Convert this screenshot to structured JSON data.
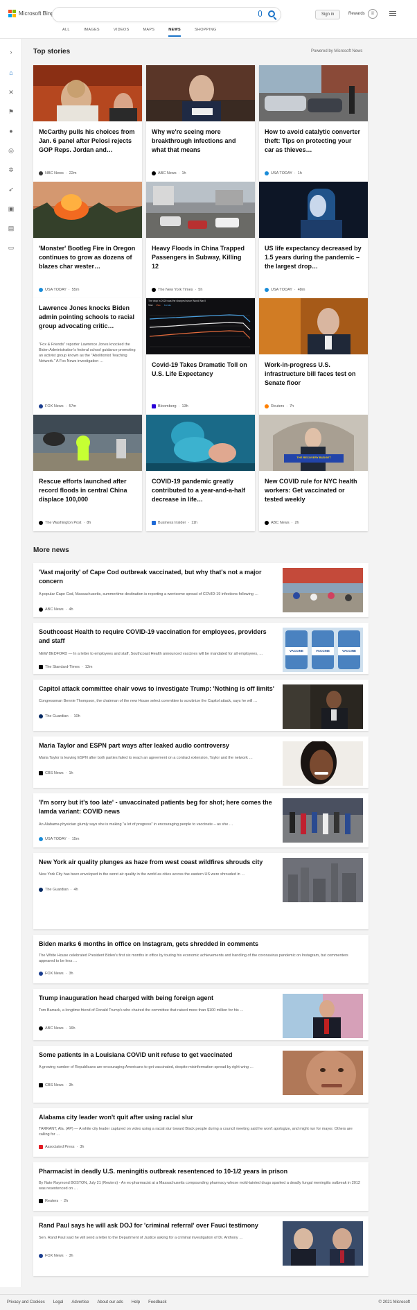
{
  "header": {
    "logo_text": "Microsoft Bing",
    "signin_label": "Sign in",
    "rewards_label": "Rewards",
    "tabs": [
      {
        "label": "ALL"
      },
      {
        "label": "IMAGES"
      },
      {
        "label": "VIDEOS"
      },
      {
        "label": "MAPS"
      },
      {
        "label": "NEWS",
        "active": true
      },
      {
        "label": "SHOPPING"
      }
    ]
  },
  "top_stories": {
    "title": "Top stories",
    "powered_by": "Powered by Microsoft News",
    "cards": [
      {
        "title": "McCarthy pulls his choices from Jan. 6 panel after Pelosi rejects GOP Reps. Jordan and…",
        "source": "NBC News",
        "age": "22m",
        "logo_color": "#333"
      },
      {
        "title": "Why we're seeing more breakthrough infections and what that means",
        "source": "ABC News",
        "age": "1h",
        "logo_color": "#000"
      },
      {
        "title": "How to avoid catalytic converter theft: Tips on protecting your car as thieves…",
        "source": "USA TODAY",
        "age": "1h",
        "logo_color": "#1a8cd8"
      },
      {
        "title": "'Monster' Bootleg Fire in Oregon continues to grow as dozens of blazes char wester…",
        "source": "USA TODAY",
        "age": "55m",
        "logo_color": "#1a8cd8"
      },
      {
        "title": "Heavy Floods in China Trapped Passengers in Subway, Killing 12",
        "source": "The New York Times",
        "age": "5h",
        "logo_color": "#000"
      },
      {
        "title": "US life expectancy decreased by 1.5 years during the pandemic – the largest drop…",
        "source": "USA TODAY",
        "age": "48m",
        "logo_color": "#1a8cd8"
      },
      {
        "title": "Lawrence Jones knocks Biden admin pointing schools to racial group advocating critic…",
        "snippet": "\"Fox & Friends\" reporter Lawrence Jones knocked the Biden Administration's federal school guidance promoting an activist group known as the \"Abolitionist Teaching Network.\" A Fox News investigation …",
        "source": "FOX News",
        "age": "57m",
        "logo_color": "#1a3d8f"
      },
      {
        "title": "Covid-19 Takes Dramatic Toll on U.S. Life Expectancy",
        "source": "Bloomberg",
        "age": "13h",
        "logo_color": "#2800d7"
      },
      {
        "title": "Work-in-progress U.S. infrastructure bill faces test on Senate floor",
        "source": "Reuters",
        "age": "7h",
        "logo_color": "#ff8000"
      },
      {
        "title": "Rescue efforts launched after record floods in central China displace 100,000",
        "source": "The Washington Post",
        "age": "8h",
        "logo_color": "#000"
      },
      {
        "title": "COVID-19 pandemic greatly contributed to a year-and-a-half decrease in life…",
        "source": "Business Insider",
        "age": "11h",
        "logo_color": "#1f6ad6"
      },
      {
        "title": "New COVID rule for NYC health workers: Get vaccinated or tested weekly",
        "source": "ABC News",
        "age": "2h",
        "logo_color": "#000"
      }
    ],
    "chart_caption": "The drop in 2020 was the sharpest since World War II",
    "chart_legend": [
      "Total",
      "Male",
      "Female"
    ],
    "banner_text": "THE RECOVERY BUDGET"
  },
  "more_news": {
    "title": "More news",
    "items": [
      {
        "title": "'Vast majority' of Cape Cod outbreak vaccinated, but why that's not a major concern",
        "snippet": "A popular Cape Cod, Massachusetts, summertime destination is reporting a worrisome spread of COVID-19 infections following …",
        "source": "ABC News",
        "age": "4h",
        "logo_color": "#000"
      },
      {
        "title": "Southcoast Health to require COVID-19 vaccination for employees, providers and staff",
        "snippet": "NEW BEDFORD — In a letter to employees and staff, Southcoast Health announced vaccines will be mandated for all employees, …",
        "source": "The Standard-Times",
        "age": "12m",
        "logo_color": "#000"
      },
      {
        "title": "Capitol attack committee chair vows to investigate Trump: 'Nothing is off limits'",
        "snippet": "Congressman Bennie Thompson, the chairman of the new House select committee to scrutinize the Capitol attack, says he will …",
        "source": "The Guardian",
        "age": "10h",
        "logo_color": "#052962"
      },
      {
        "title": "Maria Taylor and ESPN part ways after leaked audio controversy",
        "snippet": "Maria Taylor is leaving ESPN after both parties failed to reach an agreement on a contract extension, Taylor and the network …",
        "source": "CBS News",
        "age": "1h",
        "logo_color": "#000"
      },
      {
        "title": "'I'm sorry but it's too late' - unvaccinated patients beg for shot; here comes the lamda variant: COVID news",
        "snippet": "An Alabama physician glumly says she is making \"a lot of progress\" in encouraging people to vaccinate – as she …",
        "source": "USA TODAY",
        "age": "15m",
        "logo_color": "#1a8cd8"
      },
      {
        "title": "New York air quality plunges as haze from west coast wildfires shrouds city",
        "snippet": "New York City has been enveloped in the worst air quality in the world as cities across the eastern US were shrouded in …",
        "source": "The Guardian",
        "age": "4h",
        "logo_color": "#052962"
      },
      {
        "title": "Biden marks 6 months in office on Instagram, gets shredded in comments",
        "snippet": "The White House celebrated President Biden's first six months in office by touting his economic achievements and handling of the coronavirus pandemic on Instagram, but commenters appeared to be less …",
        "source": "FOX News",
        "age": "3h",
        "logo_color": "#1a3d8f"
      },
      {
        "title": "Trump inauguration head charged with being foreign agent",
        "snippet": "Tom Barrack, a longtime friend of Donald Trump's who chaired the committee that raised more than $100 million for his …",
        "source": "ABC News",
        "age": "16h",
        "logo_color": "#000"
      },
      {
        "title": "Some patients in a Louisiana COVID unit refuse to get vaccinated",
        "snippet": "A growing number of Republicans are encouraging Americans to get vaccinated, despite misinformation spread by right-wing …",
        "source": "CBS News",
        "age": "3h",
        "logo_color": "#000"
      },
      {
        "title": "Alabama city leader won't quit after using racial slur",
        "snippet": "TARRANT, Ala. (AP) — A white city leader captured on video using a racial slur toward Black people during a council meeting said he won't apologize, and might run for mayor. Others are calling for …",
        "source": "Associated Press",
        "age": "3h",
        "logo_color": "#e31b23"
      },
      {
        "title": "Pharmacist in deadly U.S. meningitis outbreak resentenced to 10-1/2 years in prison",
        "snippet": "By Nate Raymond BOSTON, July 21 (Reuters) - An ex-pharmacist at a Massachusetts compounding pharmacy whose mold-tainted drugs sparked a deadly fungal meningitis outbreak in 2012 was resentenced on …",
        "source": "Reuters",
        "age": "2h",
        "logo_color": "#000"
      },
      {
        "title": "Rand Paul says he will ask DOJ for 'criminal referral' over Fauci testimony",
        "snippet": "Sen. Rand Paul said he will send a letter to the Department of Justice asking for a criminal investigation of Dr. Anthony …",
        "source": "FOX News",
        "age": "3h",
        "logo_color": "#1a3d8f"
      }
    ],
    "vaccine_label": "VACCINE"
  },
  "footer": {
    "links": [
      "Privacy and Cookies",
      "Legal",
      "Advertise",
      "About our ads",
      "Help",
      "Feedback"
    ],
    "copyright": "© 2021 Microsoft"
  },
  "colors": {
    "accent": "#1a73c8",
    "background": "#f3f3f3"
  }
}
